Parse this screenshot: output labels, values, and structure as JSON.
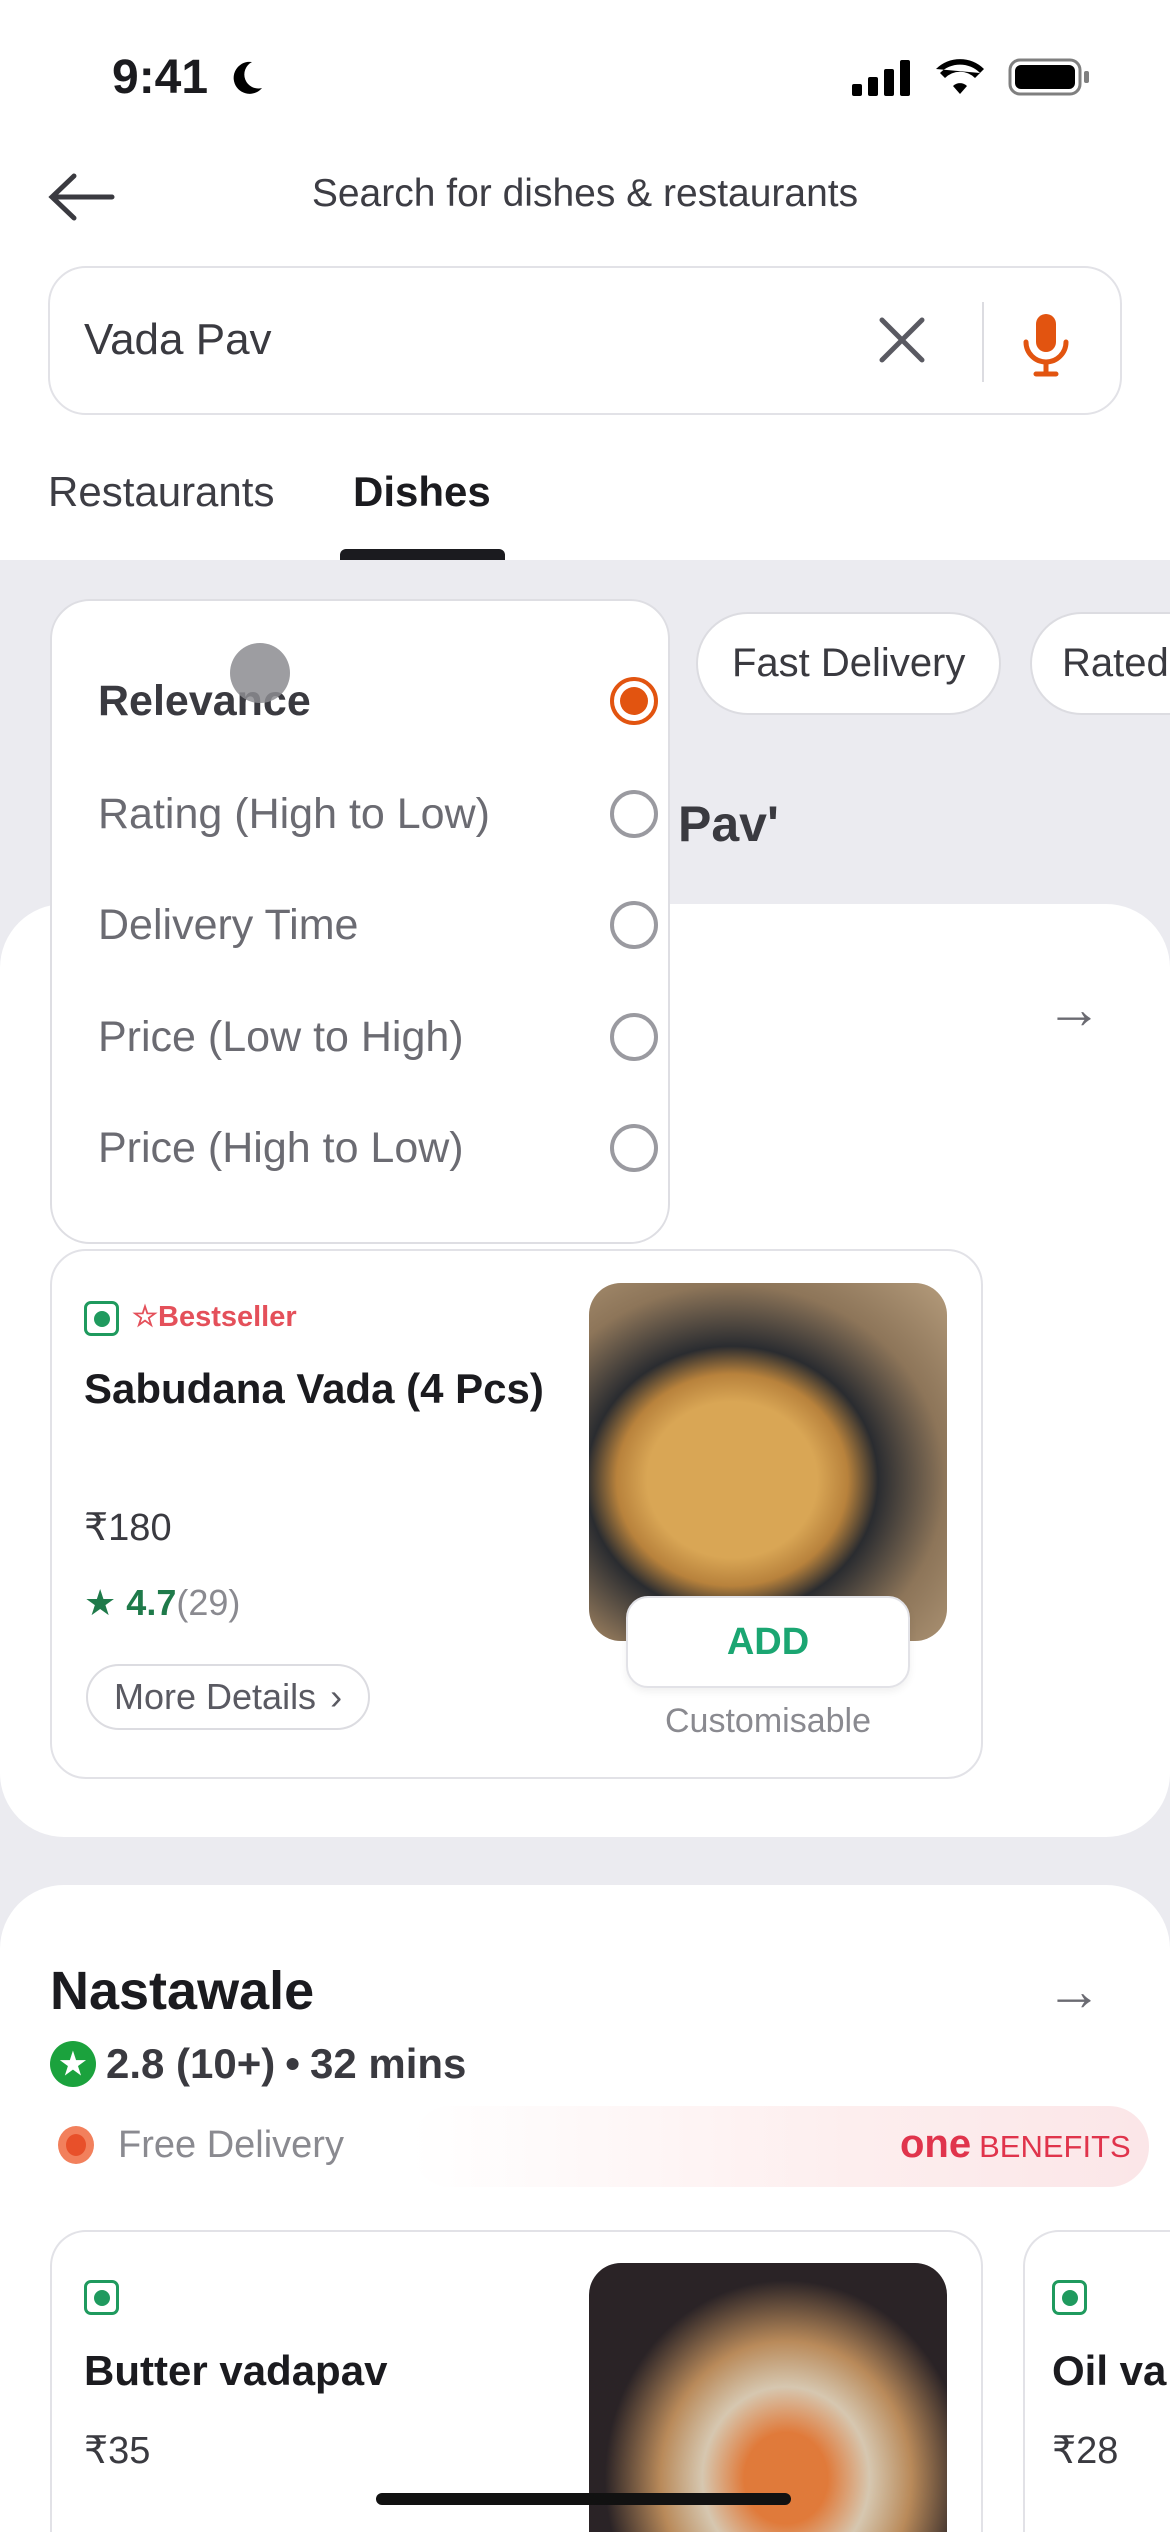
{
  "status_bar": {
    "time": "9:41",
    "icons": [
      "moon-icon",
      "signal-icon",
      "wifi-icon",
      "battery-icon"
    ]
  },
  "header": {
    "title": "Search for dishes & restaurants",
    "back_icon": "arrow-left-icon"
  },
  "search": {
    "value": "Vada Pav",
    "placeholder": "",
    "clear_icon": "close-icon",
    "mic_icon": "mic-icon"
  },
  "tabs": [
    {
      "label": "Restaurants",
      "active": false
    },
    {
      "label": "Dishes",
      "active": true
    }
  ],
  "sort_dropdown": {
    "options": [
      {
        "label": "Relevance",
        "selected": true
      },
      {
        "label": "Rating (High to Low)",
        "selected": false
      },
      {
        "label": "Delivery Time",
        "selected": false
      },
      {
        "label": "Price (Low to High)",
        "selected": false
      },
      {
        "label": "Price (High to Low)",
        "selected": false
      }
    ]
  },
  "chips": [
    "Fast Delivery",
    "Rated"
  ],
  "results_heading_fragment": "Pav'",
  "restaurant1": {
    "items": [
      {
        "badge": "Bestseller",
        "name": "Sabudana Vada (4 Pcs)",
        "price": "₹180",
        "rating": "4.7",
        "rating_count": "(29)",
        "more_label": "More Details",
        "add_label": "ADD",
        "note": "Customisable"
      }
    ]
  },
  "restaurant2": {
    "name": "Nastawale",
    "rating": "2.8 (10+)",
    "separator": "•",
    "time": "32 mins",
    "delivery": "Free Delivery",
    "benefits_brand": "one",
    "benefits_label": "BENEFITS",
    "items": [
      {
        "name": "Butter vadapav",
        "price": "₹35"
      },
      {
        "name": "Oil va",
        "price": "₹28"
      }
    ]
  },
  "colors": {
    "accent": "#e25410",
    "veg": "#1f9a5e",
    "add": "#1ba672",
    "bestseller": "#e4505a"
  }
}
